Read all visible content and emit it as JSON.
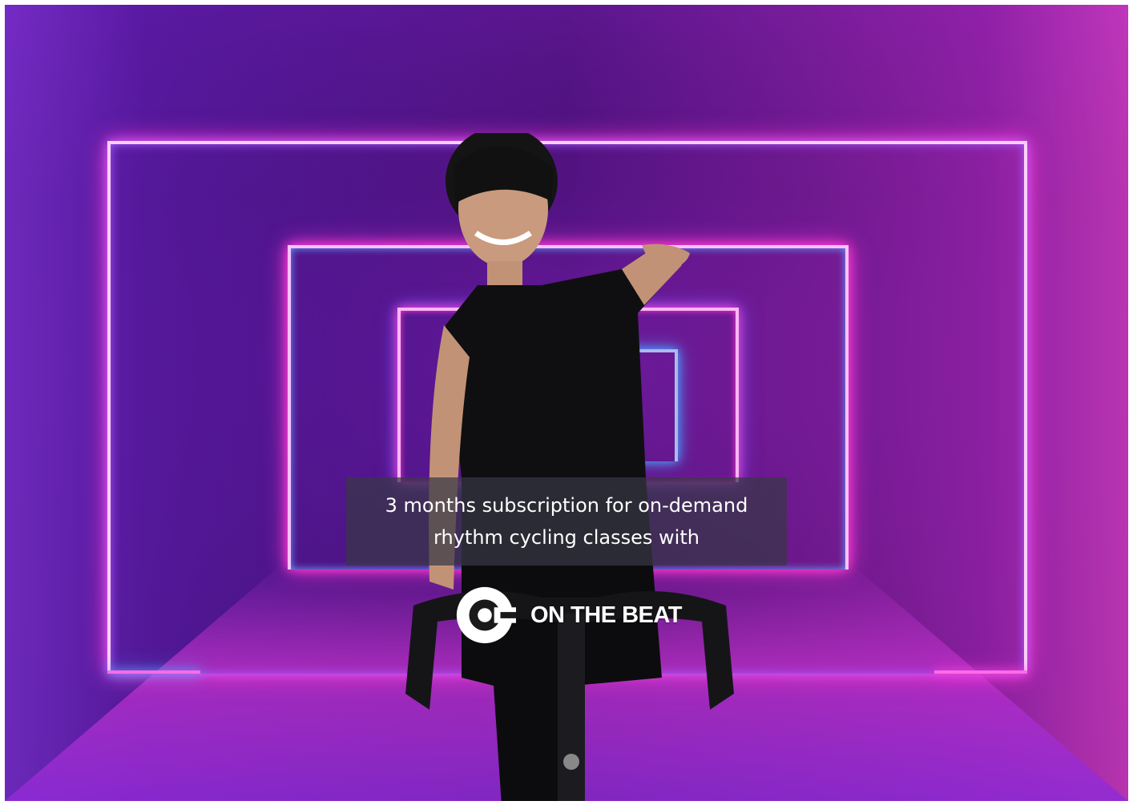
{
  "promo": {
    "caption": "3 months subscription for on-demand rhythm cycling classes with",
    "brand_name": "ON THE BEAT"
  },
  "icons": {
    "brand_logo": "on-the-beat-logo-icon"
  },
  "colors": {
    "neon_pink": "#ff39d6",
    "neon_blue": "#4aa8ff",
    "background_purple": "#4b1178",
    "caption_bg": "#37374680",
    "text": "#ffffff"
  }
}
